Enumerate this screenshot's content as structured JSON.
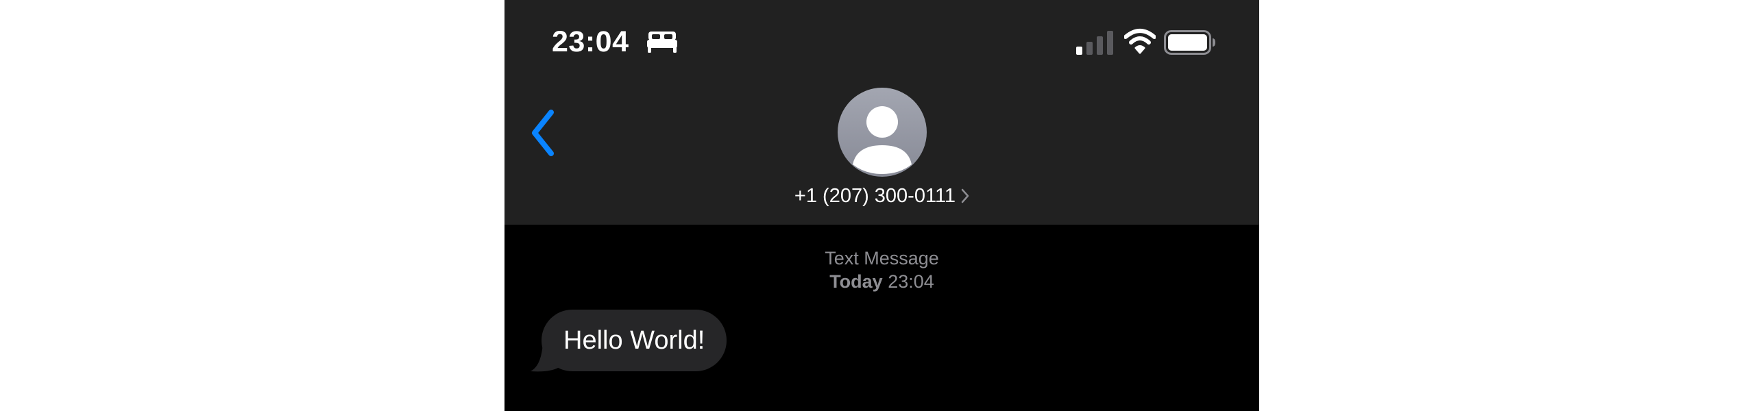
{
  "status_bar": {
    "time": "23:04",
    "icons": [
      "bed-icon",
      "signal-icon",
      "wifi-icon",
      "battery-icon"
    ]
  },
  "nav": {
    "back_icon": "chevron-left-icon",
    "contact_name": "+1 (207) 300-0111",
    "avatar_icon": "person-silhouette-icon"
  },
  "conversation": {
    "service_label": "Text Message",
    "date_label": "Today",
    "time_label": "23:04",
    "messages": [
      {
        "direction": "incoming",
        "text": "Hello World!"
      }
    ]
  },
  "colors": {
    "header_bg": "#212121",
    "conversation_bg": "#000000",
    "accent": "#0a84ff",
    "incoming_bubble": "#262628",
    "meta_text": "#8e8e93"
  }
}
